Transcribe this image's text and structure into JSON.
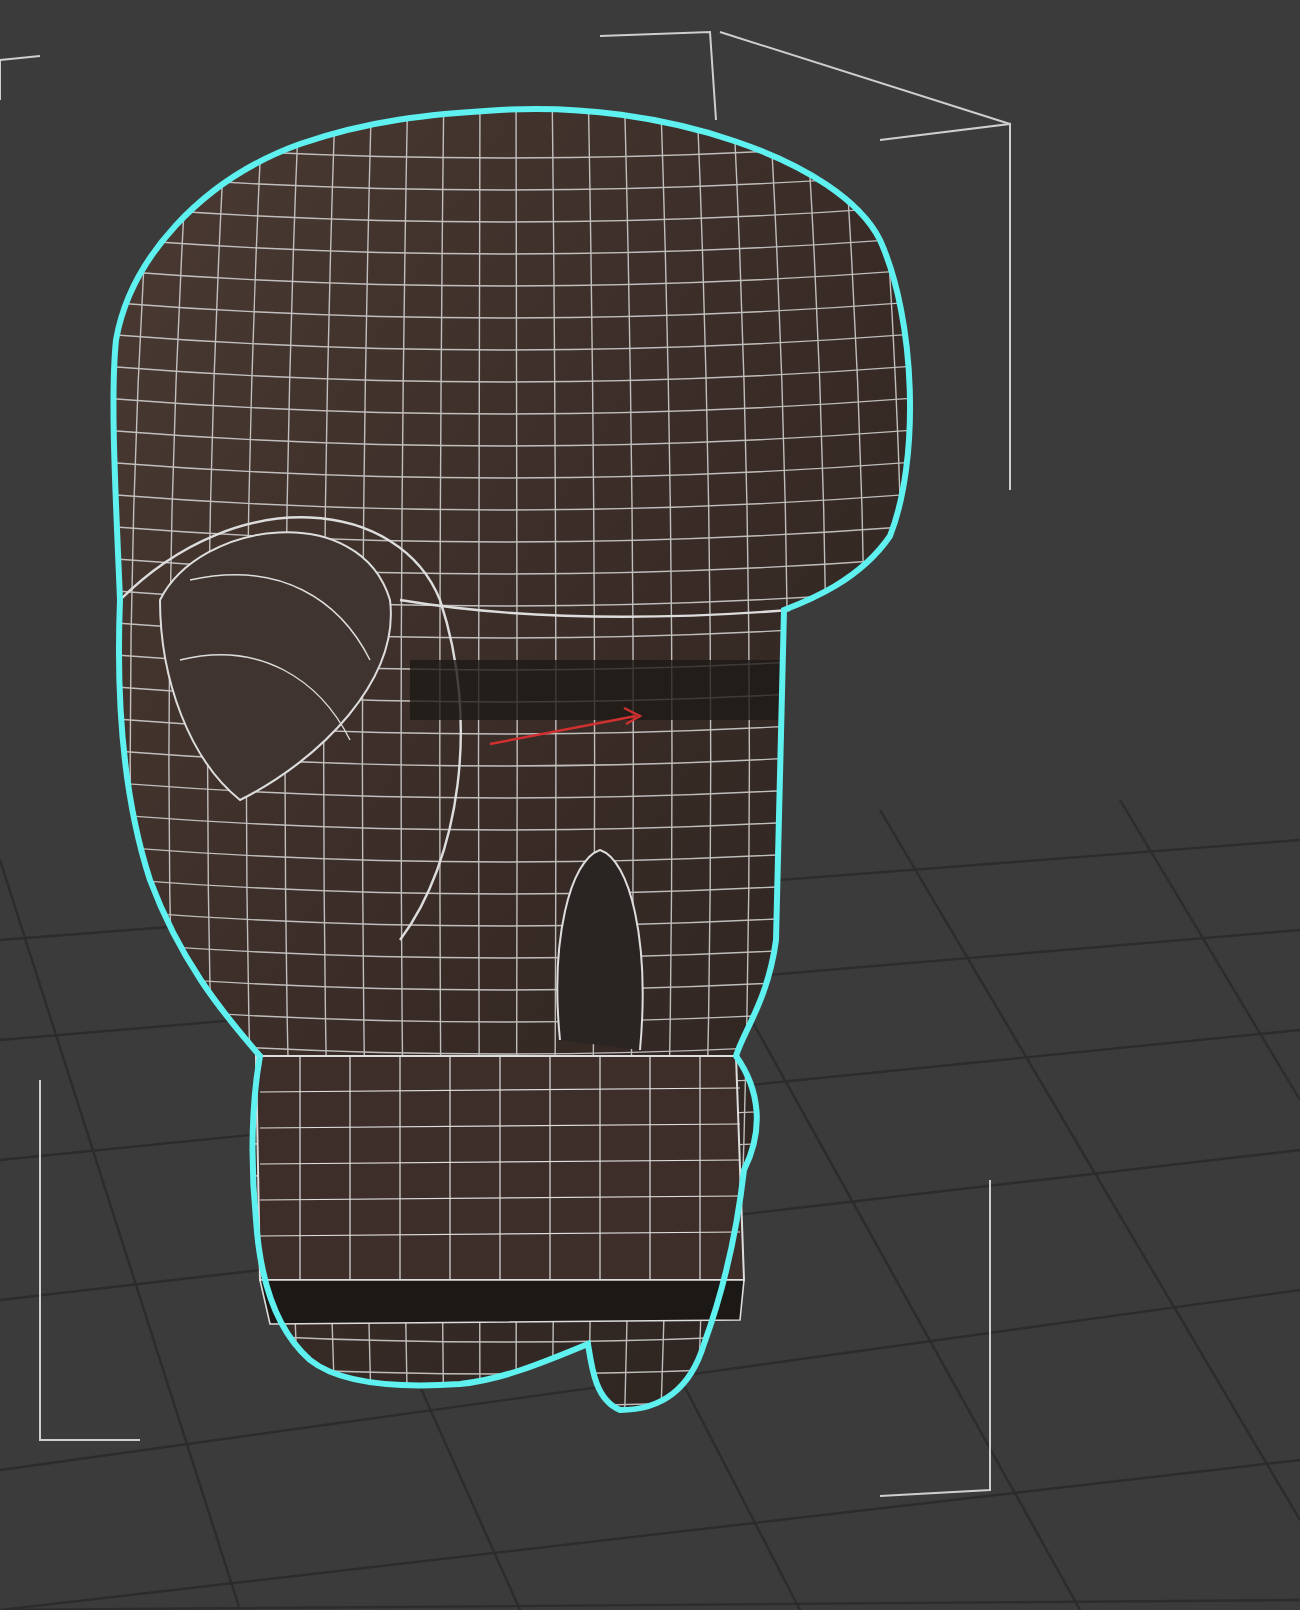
{
  "viewport": {
    "selected": true
  }
}
